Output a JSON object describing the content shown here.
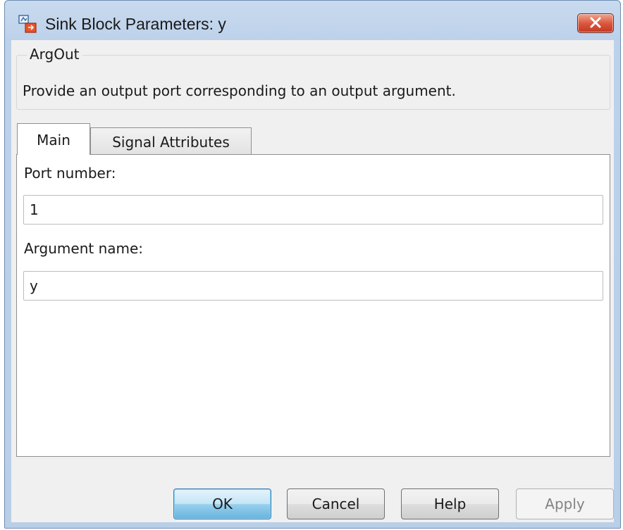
{
  "window": {
    "title": "Sink Block Parameters: y",
    "app_icon": "simulink-block-icon",
    "close_icon": "close-icon"
  },
  "block": {
    "name": "ArgOut",
    "description": "Provide an output port corresponding to an output argument."
  },
  "tabs": [
    {
      "label": "Main",
      "selected": true
    },
    {
      "label": "Signal Attributes",
      "selected": false
    }
  ],
  "main": {
    "port_number_label": "Port number:",
    "port_number_value": "1",
    "argument_name_label": "Argument name:",
    "argument_name_value": "y"
  },
  "buttons": {
    "ok": "OK",
    "cancel": "Cancel",
    "help": "Help",
    "apply": "Apply"
  },
  "colors": {
    "close_button": "#d9523a",
    "default_button": "#98d1ef",
    "title_bar": "#bcd1ea"
  }
}
